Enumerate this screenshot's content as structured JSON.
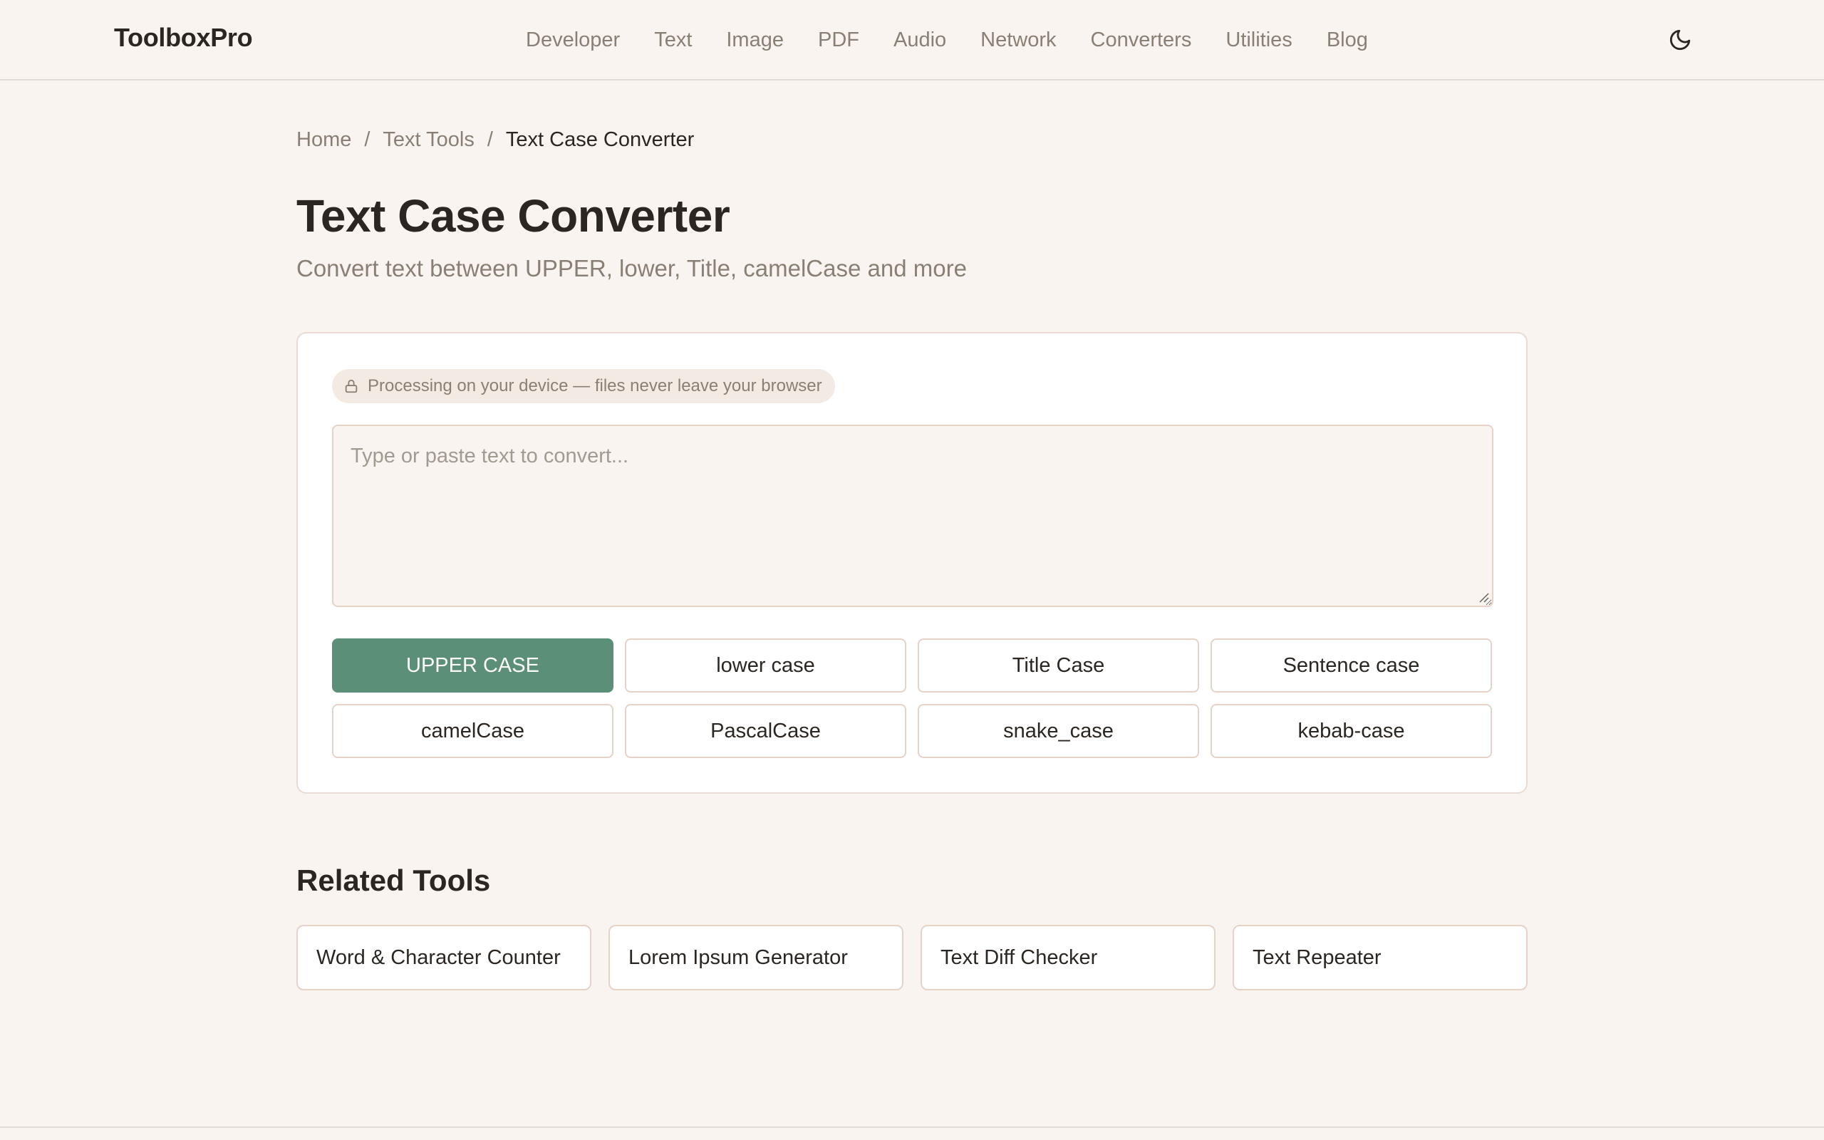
{
  "header": {
    "brand": "ToolboxPro",
    "nav": [
      "Developer",
      "Text",
      "Image",
      "PDF",
      "Audio",
      "Network",
      "Converters",
      "Utilities",
      "Blog"
    ],
    "theme_icon": "moon-icon"
  },
  "breadcrumb": {
    "items": [
      "Home",
      "Text Tools"
    ],
    "separator": "/",
    "current": "Text Case Converter"
  },
  "page": {
    "title": "Text Case Converter",
    "subtitle": "Convert text between UPPER, lower, Title, camelCase and more"
  },
  "tool": {
    "privacy_icon": "lock-icon",
    "privacy_text": "Processing on your device — files never leave your browser",
    "input_value": "",
    "input_placeholder": "Type or paste text to convert...",
    "buttons": [
      "UPPER CASE",
      "lower case",
      "Title Case",
      "Sentence case",
      "camelCase",
      "PascalCase",
      "snake_case",
      "kebab-case"
    ],
    "active_button": "UPPER CASE"
  },
  "related": {
    "title": "Related Tools",
    "items": [
      "Word & Character Counter",
      "Lorem Ipsum Generator",
      "Text Diff Checker",
      "Text Repeater"
    ]
  },
  "colors": {
    "background": "#f9f4ef",
    "accent": "#5b8f78",
    "text": "#2b2621",
    "muted": "#8a7f74",
    "border": "#e6d2c6"
  }
}
